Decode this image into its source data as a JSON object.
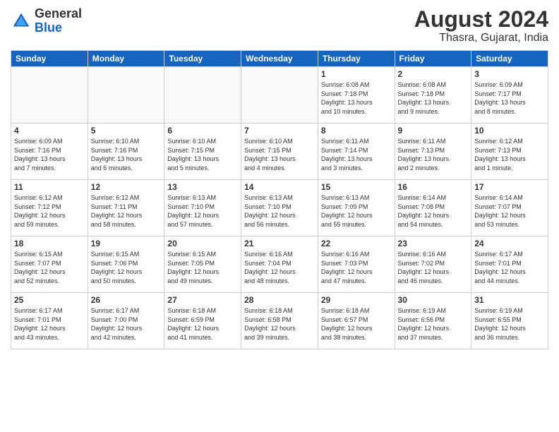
{
  "header": {
    "logo_general": "General",
    "logo_blue": "Blue",
    "month_year": "August 2024",
    "location": "Thasra, Gujarat, India"
  },
  "days_of_week": [
    "Sunday",
    "Monday",
    "Tuesday",
    "Wednesday",
    "Thursday",
    "Friday",
    "Saturday"
  ],
  "weeks": [
    [
      {
        "day": "",
        "info": ""
      },
      {
        "day": "",
        "info": ""
      },
      {
        "day": "",
        "info": ""
      },
      {
        "day": "",
        "info": ""
      },
      {
        "day": "1",
        "info": "Sunrise: 6:08 AM\nSunset: 7:18 PM\nDaylight: 13 hours\nand 10 minutes."
      },
      {
        "day": "2",
        "info": "Sunrise: 6:08 AM\nSunset: 7:18 PM\nDaylight: 13 hours\nand 9 minutes."
      },
      {
        "day": "3",
        "info": "Sunrise: 6:09 AM\nSunset: 7:17 PM\nDaylight: 13 hours\nand 8 minutes."
      }
    ],
    [
      {
        "day": "4",
        "info": "Sunrise: 6:09 AM\nSunset: 7:16 PM\nDaylight: 13 hours\nand 7 minutes."
      },
      {
        "day": "5",
        "info": "Sunrise: 6:10 AM\nSunset: 7:16 PM\nDaylight: 13 hours\nand 6 minutes."
      },
      {
        "day": "6",
        "info": "Sunrise: 6:10 AM\nSunset: 7:15 PM\nDaylight: 13 hours\nand 5 minutes."
      },
      {
        "day": "7",
        "info": "Sunrise: 6:10 AM\nSunset: 7:15 PM\nDaylight: 13 hours\nand 4 minutes."
      },
      {
        "day": "8",
        "info": "Sunrise: 6:11 AM\nSunset: 7:14 PM\nDaylight: 13 hours\nand 3 minutes."
      },
      {
        "day": "9",
        "info": "Sunrise: 6:11 AM\nSunset: 7:13 PM\nDaylight: 13 hours\nand 2 minutes."
      },
      {
        "day": "10",
        "info": "Sunrise: 6:12 AM\nSunset: 7:13 PM\nDaylight: 13 hours\nand 1 minute."
      }
    ],
    [
      {
        "day": "11",
        "info": "Sunrise: 6:12 AM\nSunset: 7:12 PM\nDaylight: 12 hours\nand 59 minutes."
      },
      {
        "day": "12",
        "info": "Sunrise: 6:12 AM\nSunset: 7:11 PM\nDaylight: 12 hours\nand 58 minutes."
      },
      {
        "day": "13",
        "info": "Sunrise: 6:13 AM\nSunset: 7:10 PM\nDaylight: 12 hours\nand 57 minutes."
      },
      {
        "day": "14",
        "info": "Sunrise: 6:13 AM\nSunset: 7:10 PM\nDaylight: 12 hours\nand 56 minutes."
      },
      {
        "day": "15",
        "info": "Sunrise: 6:13 AM\nSunset: 7:09 PM\nDaylight: 12 hours\nand 55 minutes."
      },
      {
        "day": "16",
        "info": "Sunrise: 6:14 AM\nSunset: 7:08 PM\nDaylight: 12 hours\nand 54 minutes."
      },
      {
        "day": "17",
        "info": "Sunrise: 6:14 AM\nSunset: 7:07 PM\nDaylight: 12 hours\nand 53 minutes."
      }
    ],
    [
      {
        "day": "18",
        "info": "Sunrise: 6:15 AM\nSunset: 7:07 PM\nDaylight: 12 hours\nand 52 minutes."
      },
      {
        "day": "19",
        "info": "Sunrise: 6:15 AM\nSunset: 7:06 PM\nDaylight: 12 hours\nand 50 minutes."
      },
      {
        "day": "20",
        "info": "Sunrise: 6:15 AM\nSunset: 7:05 PM\nDaylight: 12 hours\nand 49 minutes."
      },
      {
        "day": "21",
        "info": "Sunrise: 6:16 AM\nSunset: 7:04 PM\nDaylight: 12 hours\nand 48 minutes."
      },
      {
        "day": "22",
        "info": "Sunrise: 6:16 AM\nSunset: 7:03 PM\nDaylight: 12 hours\nand 47 minutes."
      },
      {
        "day": "23",
        "info": "Sunrise: 6:16 AM\nSunset: 7:02 PM\nDaylight: 12 hours\nand 46 minutes."
      },
      {
        "day": "24",
        "info": "Sunrise: 6:17 AM\nSunset: 7:01 PM\nDaylight: 12 hours\nand 44 minutes."
      }
    ],
    [
      {
        "day": "25",
        "info": "Sunrise: 6:17 AM\nSunset: 7:01 PM\nDaylight: 12 hours\nand 43 minutes."
      },
      {
        "day": "26",
        "info": "Sunrise: 6:17 AM\nSunset: 7:00 PM\nDaylight: 12 hours\nand 42 minutes."
      },
      {
        "day": "27",
        "info": "Sunrise: 6:18 AM\nSunset: 6:59 PM\nDaylight: 12 hours\nand 41 minutes."
      },
      {
        "day": "28",
        "info": "Sunrise: 6:18 AM\nSunset: 6:58 PM\nDaylight: 12 hours\nand 39 minutes."
      },
      {
        "day": "29",
        "info": "Sunrise: 6:18 AM\nSunset: 6:57 PM\nDaylight: 12 hours\nand 38 minutes."
      },
      {
        "day": "30",
        "info": "Sunrise: 6:19 AM\nSunset: 6:56 PM\nDaylight: 12 hours\nand 37 minutes."
      },
      {
        "day": "31",
        "info": "Sunrise: 6:19 AM\nSunset: 6:55 PM\nDaylight: 12 hours\nand 36 minutes."
      }
    ]
  ]
}
